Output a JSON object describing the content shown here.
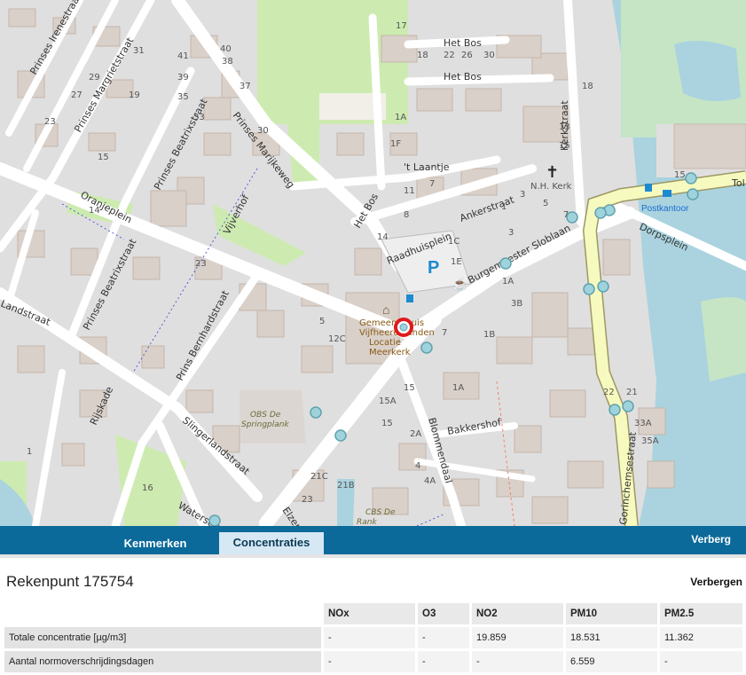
{
  "map": {
    "streets": [
      "Prinses Irenestraat",
      "Prinses Margrietstraat",
      "Prinses Beatrixstraat",
      "Prinses Marijkeweg",
      "Oranjeplein",
      "Vijverhof",
      "Het Bos",
      "'t Laantje",
      "Raadhuisplein",
      "Ankerstraat",
      "Burgemeester Sloblaan",
      "Kerkstraat",
      "Dorpsplein",
      "Prins Bernhardstraat",
      "Slingerlandstraat",
      "Rijskade",
      "Blommendaal",
      "Bakkershof",
      "Gorinchemsestraat",
      "Waterstraat",
      "Elzenstraat",
      "Tol",
      "Het Bos",
      "Prinses Beatrixstraat",
      "Landstraat"
    ],
    "pois": {
      "church": "N.H. Kerk",
      "post": "Postkantoor",
      "townhall": "Gemeentehuis Vijfheerenlanden Locatie Meerkerk",
      "school1": "OBS De Springplank",
      "school2": "CBS De Rank",
      "parking": "P"
    },
    "house_numbers": [
      "40",
      "41",
      "39",
      "38",
      "35",
      "37",
      "36",
      "33",
      "30",
      "17",
      "29",
      "31",
      "32",
      "28",
      "27",
      "23",
      "25",
      "15",
      "13",
      "11",
      "9",
      "7",
      "5",
      "3",
      "1",
      "1A",
      "1F",
      "1E",
      "1D",
      "1C",
      "1B",
      "12",
      "14",
      "16",
      "18",
      "20",
      "22",
      "24",
      "26",
      "28",
      "30",
      "4",
      "6",
      "8",
      "10",
      "2A",
      "2",
      "15A",
      "15",
      "13",
      "11",
      "9",
      "7",
      "5",
      "3",
      "1",
      "21C",
      "21B",
      "19",
      "23",
      "25",
      "21A",
      "4A",
      "1A",
      "1B",
      "3A",
      "3B",
      "21",
      "22",
      "33",
      "33A",
      "35A",
      "18"
    ]
  },
  "tabs": {
    "kenmerken": "Kenmerken",
    "concentraties": "Concentraties",
    "hide": "Verberg"
  },
  "panel": {
    "title": "Rekenpunt 175754",
    "hide": "Verbergen",
    "columns": [
      "NOx",
      "O3",
      "NO2",
      "PM10",
      "PM2.5"
    ],
    "rows": [
      {
        "label": "Totale concentratie [µg/m3]",
        "values": [
          "-",
          "-",
          "19.859",
          "18.531",
          "11.362"
        ]
      },
      {
        "label": "Aantal normoverschrijdingsdagen",
        "values": [
          "-",
          "-",
          "-",
          "6.559",
          "-"
        ]
      }
    ]
  }
}
